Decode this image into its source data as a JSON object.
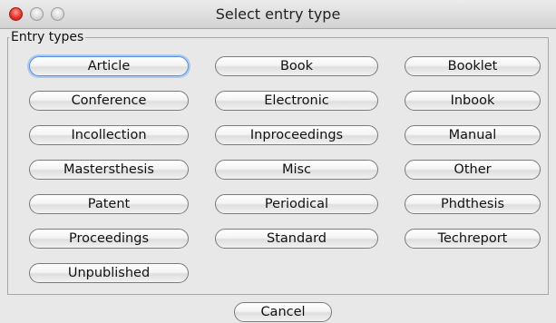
{
  "window": {
    "title": "Select entry type"
  },
  "group": {
    "label": "Entry types"
  },
  "entry_types": [
    "Article",
    "Book",
    "Booklet",
    "Conference",
    "Electronic",
    "Inbook",
    "Incollection",
    "Inproceedings",
    "Manual",
    "Mastersthesis",
    "Misc",
    "Other",
    "Patent",
    "Periodical",
    "Phdthesis",
    "Proceedings",
    "Standard",
    "Techreport",
    "Unpublished"
  ],
  "footer": {
    "cancel_label": "Cancel"
  },
  "colors": {
    "close_button": "#e3362b",
    "focus_ring": "#a9c8f2",
    "window_bg": "#e8e8e8"
  }
}
